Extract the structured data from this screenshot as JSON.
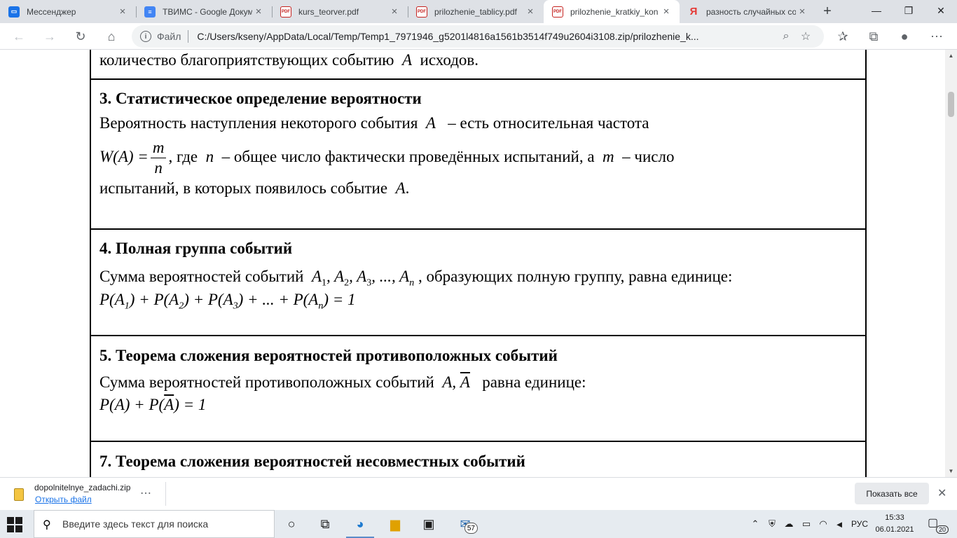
{
  "browser": {
    "tabs": [
      {
        "title": "Мессенджер",
        "favicon": "messenger-icon"
      },
      {
        "title": "ТВИМС - Google Докум",
        "favicon": "google-docs-icon"
      },
      {
        "title": "kurs_teorver.pdf",
        "favicon": "pdf-icon"
      },
      {
        "title": "prilozhenie_tablicy.pdf",
        "favicon": "pdf-icon"
      },
      {
        "title": "prilozhenie_kratkiy_kon",
        "favicon": "pdf-icon",
        "active": true
      },
      {
        "title": "разность случайных со",
        "favicon": "yandex-icon"
      }
    ],
    "favicon_pdf_text": "PDF",
    "favicon_ya_text": "Я",
    "address": {
      "scheme_label": "Файл",
      "url": "C:/Users/kseny/AppData/Local/Temp/Temp1_7971946_g5201l4816a1561b3514f749u2604i3108.zip/prilozhenie_k..."
    }
  },
  "document": {
    "sec2_tail": {
      "text": "количество благоприятствующих событию",
      "var": "A",
      "end": "исходов."
    },
    "sec3": {
      "heading": "3. Статистическое определение вероятности",
      "line1": {
        "text": "Вероятность наступления некоторого события",
        "var": "A",
        "end": "– есть относительная частота"
      },
      "formula": {
        "lhs": "W(A) =",
        "num": "m",
        "den": "n"
      },
      "line2": {
        "text": ", где",
        "var1": "n",
        "mid": "– общее число фактически проведённых испытаний, а",
        "var2": "m",
        "end": "– число"
      },
      "line3": {
        "text": "испытаний, в которых появилось событие",
        "var": "A",
        "end": "."
      }
    },
    "sec4": {
      "heading": "4. Полная группа событий",
      "line1": {
        "text": "Сумма вероятностей событий",
        "end": ", образующих полную группу, равна единице:"
      },
      "events": [
        "A",
        "1",
        ", A",
        "2",
        ", A",
        "3",
        ", ..., A",
        "n"
      ],
      "formula": [
        "P(A",
        "1",
        ") + P(A",
        "2",
        ") + P(A",
        "3",
        ") + ... + P(A",
        "n",
        ") = 1"
      ]
    },
    "sec5": {
      "heading": "5. Теорема сложения вероятностей противоположных событий",
      "line1": {
        "text": "Сумма вероятностей противоположных событий",
        "var1": "A,",
        "var2": "A",
        "end": "равна единице:"
      },
      "formula": {
        "pre": "P(A) + P(",
        "bar": "A",
        "post": ") = 1"
      }
    },
    "sec7": {
      "heading": "7. Теорема сложения вероятностей несовместных событий"
    }
  },
  "downloads": {
    "file_name": "dopolnitelnye_zadachi.zip",
    "open_label": "Открыть файл",
    "show_all_label": "Показать все"
  },
  "taskbar": {
    "search_placeholder": "Введите здесь текст для поиска",
    "mail_badge": "57",
    "lang": "РУС",
    "time": "15:33",
    "date": "06.01.2021",
    "notifications": "20"
  },
  "colors": {
    "accent": "#1a73e8",
    "taskbar_bg": "#e6ebf0",
    "tabbar_bg": "#dee1e6"
  }
}
